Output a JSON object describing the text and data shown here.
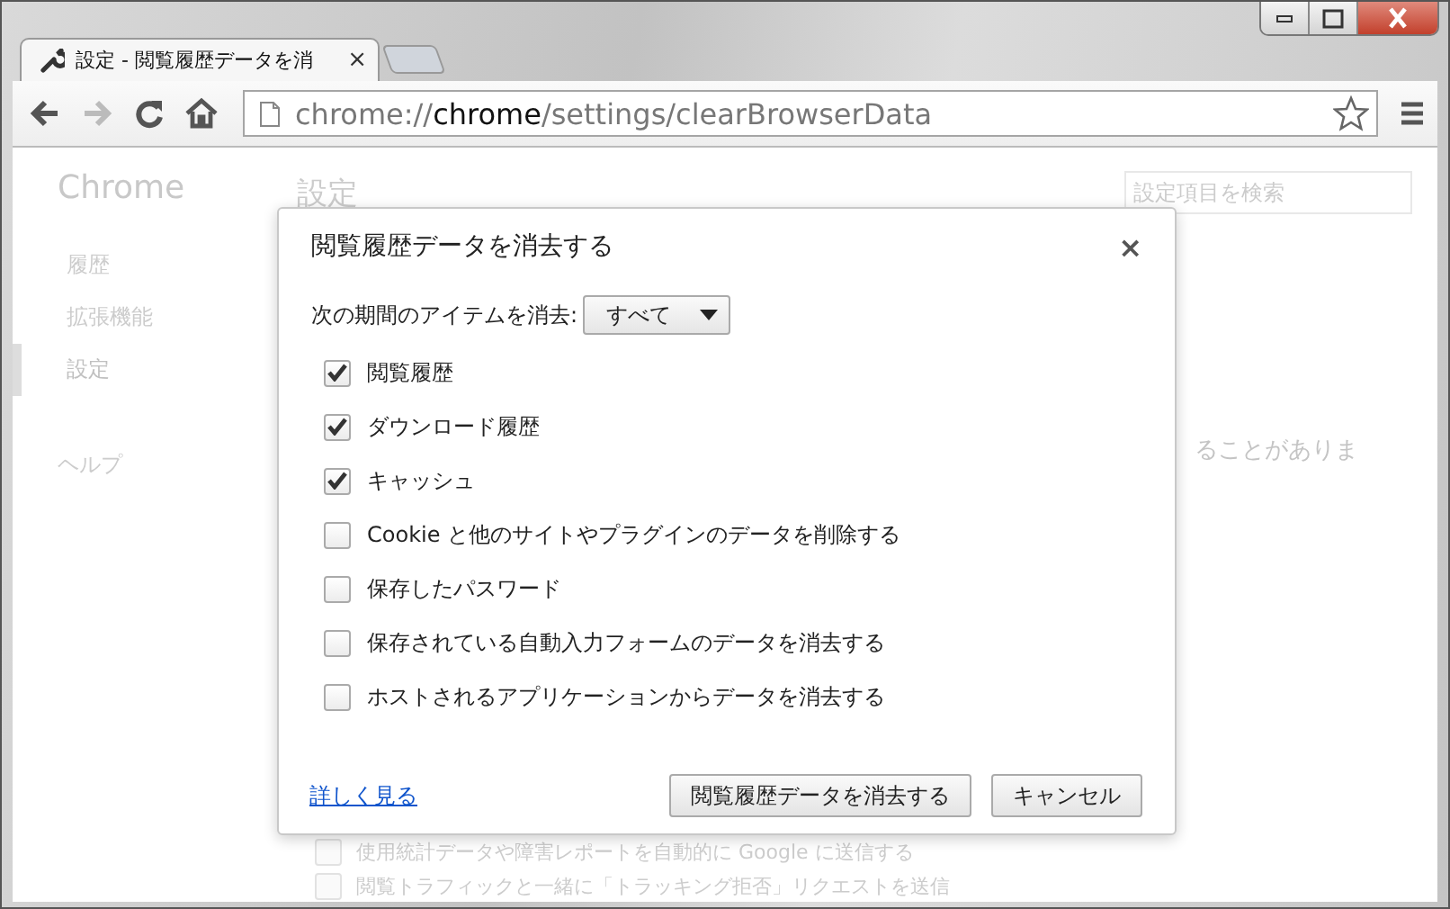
{
  "tabs": [
    {
      "title": "設定 - 閲覧履歴データを消",
      "close": "×",
      "selected": true
    }
  ],
  "toolbar": {
    "url": {
      "scheme": "chrome://",
      "host": "chrome",
      "path": "/settings/clearBrowserData"
    }
  },
  "sidebar": {
    "title": "Chrome",
    "items": [
      {
        "label": "履歴",
        "selected": false
      },
      {
        "label": "拡張機能",
        "selected": false
      },
      {
        "label": "設定",
        "selected": true
      }
    ],
    "help": "ヘルプ"
  },
  "page": {
    "title": "設定",
    "search": {
      "placeholder": "設定項目を検索"
    },
    "partial_text": "ることがありま",
    "options": [
      {
        "label": "使用統計データや障害レポートを自動的に Google に送信する",
        "checked": false
      },
      {
        "label": "閲覧トラフィックと一緒に「トラッキング拒否」リクエストを送信",
        "checked": false
      }
    ]
  },
  "dialog": {
    "title": "閲覧履歴データを消去する",
    "close": "×",
    "period_label": "次の期間のアイテムを消去:",
    "period_value": "すべて",
    "items": [
      {
        "label": "閲覧履歴",
        "checked": true
      },
      {
        "label": "ダウンロード履歴",
        "checked": true
      },
      {
        "label": "キャッシュ",
        "checked": true
      },
      {
        "label": "Cookie と他のサイトやプラグインのデータを削除する",
        "checked": false
      },
      {
        "label": "保存したパスワード",
        "checked": false
      },
      {
        "label": "保存されている自動入力フォームのデータを消去する",
        "checked": false
      },
      {
        "label": "ホストされるアプリケーションからデータを消去する",
        "checked": false
      }
    ],
    "link": "詳しく見る",
    "buttons": [
      "閲覧履歴データを消去する",
      "キャンセル"
    ]
  }
}
